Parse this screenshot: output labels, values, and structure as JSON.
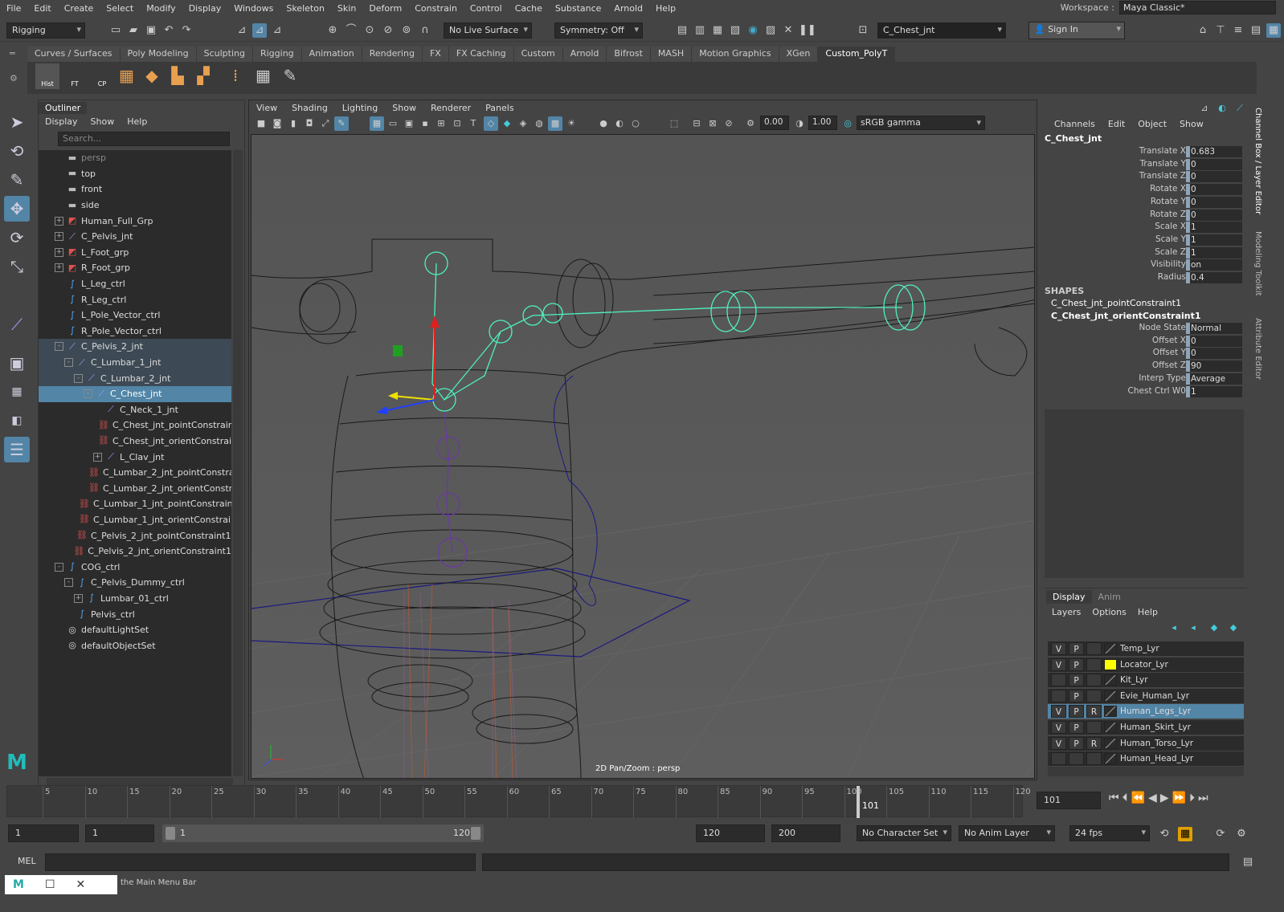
{
  "menu": [
    "File",
    "Edit",
    "Create",
    "Select",
    "Modify",
    "Display",
    "Windows",
    "Skeleton",
    "Skin",
    "Deform",
    "Constrain",
    "Control",
    "Cache",
    "Substance",
    "Arnold",
    "Help"
  ],
  "workspace": {
    "label": "Workspace :",
    "value": "Maya Classic*"
  },
  "status": {
    "mode": "Rigging",
    "live_surface": "No Live Surface",
    "symmetry": "Symmetry: Off",
    "selection": "C_Chest_jnt",
    "sign_in": "Sign In"
  },
  "shelf": {
    "tabs": [
      "Curves / Surfaces",
      "Poly Modeling",
      "Sculpting",
      "Rigging",
      "Animation",
      "Rendering",
      "FX",
      "FX Caching",
      "Custom",
      "Arnold",
      "Bifrost",
      "MASH",
      "Motion Graphics",
      "XGen",
      "Custom_PolyT"
    ],
    "active": "Custom_PolyT",
    "buttons": [
      "Hist",
      "FT",
      "CP"
    ]
  },
  "outliner": {
    "title": "Outliner",
    "menu": [
      "Display",
      "Show",
      "Help"
    ],
    "search_placeholder": "Search...",
    "items": [
      {
        "label": "persp",
        "depth": 0,
        "icon": "camera",
        "dim": true
      },
      {
        "label": "top",
        "depth": 0,
        "icon": "camera"
      },
      {
        "label": "front",
        "depth": 0,
        "icon": "camera"
      },
      {
        "label": "side",
        "depth": 0,
        "icon": "camera"
      },
      {
        "label": "Human_Full_Grp",
        "depth": 0,
        "icon": "group",
        "exp": "+"
      },
      {
        "label": "C_Pelvis_jnt",
        "depth": 0,
        "icon": "joint",
        "exp": "+"
      },
      {
        "label": "L_Foot_grp",
        "depth": 0,
        "icon": "group",
        "exp": "+"
      },
      {
        "label": "R_Foot_grp",
        "depth": 0,
        "icon": "group",
        "exp": "+"
      },
      {
        "label": "L_Leg_ctrl",
        "depth": 0,
        "icon": "curve"
      },
      {
        "label": "R_Leg_ctrl",
        "depth": 0,
        "icon": "curve"
      },
      {
        "label": "L_Pole_Vector_ctrl",
        "depth": 0,
        "icon": "curve"
      },
      {
        "label": "R_Pole_Vector_ctrl",
        "depth": 0,
        "icon": "curve"
      },
      {
        "label": "C_Pelvis_2_jnt",
        "depth": 0,
        "icon": "joint",
        "exp": "-",
        "parent": true
      },
      {
        "label": "C_Lumbar_1_jnt",
        "depth": 1,
        "icon": "joint",
        "exp": "-",
        "parent": true
      },
      {
        "label": "C_Lumbar_2_jnt",
        "depth": 2,
        "icon": "joint",
        "exp": "-",
        "parent": true
      },
      {
        "label": "C_Chest_jnt",
        "depth": 3,
        "icon": "joint",
        "exp": "-",
        "sel": true
      },
      {
        "label": "C_Neck_1_jnt",
        "depth": 4,
        "icon": "joint"
      },
      {
        "label": "C_Chest_jnt_pointConstrain",
        "depth": 4,
        "icon": "constraint"
      },
      {
        "label": "C_Chest_jnt_orientConstrai",
        "depth": 4,
        "icon": "constraint"
      },
      {
        "label": "L_Clav_jnt",
        "depth": 4,
        "icon": "joint",
        "exp": "+"
      },
      {
        "label": "C_Lumbar_2_jnt_pointConstra",
        "depth": 3,
        "icon": "constraint"
      },
      {
        "label": "C_Lumbar_2_jnt_orientConstra",
        "depth": 3,
        "icon": "constraint"
      },
      {
        "label": "C_Lumbar_1_jnt_pointConstraint",
        "depth": 2,
        "icon": "constraint"
      },
      {
        "label": "C_Lumbar_1_jnt_orientConstrain",
        "depth": 2,
        "icon": "constraint"
      },
      {
        "label": "C_Pelvis_2_jnt_pointConstraint1",
        "depth": 1,
        "icon": "constraint"
      },
      {
        "label": "C_Pelvis_2_jnt_orientConstraint1",
        "depth": 1,
        "icon": "constraint"
      },
      {
        "label": "COG_ctrl",
        "depth": 0,
        "icon": "curve",
        "exp": "-"
      },
      {
        "label": "C_Pelvis_Dummy_ctrl",
        "depth": 1,
        "icon": "curve",
        "exp": "-"
      },
      {
        "label": "Lumbar_01_ctrl",
        "depth": 2,
        "icon": "curve",
        "exp": "+"
      },
      {
        "label": "Pelvis_ctrl",
        "depth": 1,
        "icon": "curve"
      },
      {
        "label": "defaultLightSet",
        "depth": 0,
        "icon": "set"
      },
      {
        "label": "defaultObjectSet",
        "depth": 0,
        "icon": "set"
      }
    ]
  },
  "viewport": {
    "menu": [
      "View",
      "Shading",
      "Lighting",
      "Show",
      "Renderer",
      "Panels"
    ],
    "near": "0.00",
    "far": "1.00",
    "colorspace": "sRGB gamma",
    "label": "2D Pan/Zoom : persp"
  },
  "channelbox": {
    "menu": [
      "Channels",
      "Edit",
      "Object",
      "Show"
    ],
    "object": "C_Chest_jnt",
    "attrs": [
      [
        "Translate X",
        "0.683"
      ],
      [
        "Translate Y",
        "0"
      ],
      [
        "Translate Z",
        "0"
      ],
      [
        "Rotate X",
        "0"
      ],
      [
        "Rotate Y",
        "0"
      ],
      [
        "Rotate Z",
        "0"
      ],
      [
        "Scale X",
        "1"
      ],
      [
        "Scale Y",
        "1"
      ],
      [
        "Scale Z",
        "1"
      ],
      [
        "Visibility",
        "on"
      ],
      [
        "Radius",
        "0.4"
      ]
    ],
    "shapes_label": "SHAPES",
    "shapes": [
      "C_Chest_jnt_pointConstraint1",
      "C_Chest_jnt_orientConstraint1"
    ],
    "constraint_attrs": [
      [
        "Node State",
        "Normal"
      ],
      [
        "Offset X",
        "0"
      ],
      [
        "Offset Y",
        "0"
      ],
      [
        "Offset Z",
        "90"
      ],
      [
        "Interp Type",
        "Average"
      ],
      [
        "Chest Ctrl W0",
        "1"
      ]
    ]
  },
  "sidetabs": [
    "Channel Box / Layer Editor",
    "Modeling Toolkit",
    "Attribute Editor"
  ],
  "layers": {
    "tabs": [
      "Display",
      "Anim"
    ],
    "menu": [
      "Layers",
      "Options",
      "Help"
    ],
    "rows": [
      {
        "name": "Temp_Lyr",
        "v": "V",
        "p": "P",
        "r": "",
        "color": ""
      },
      {
        "name": "Locator_Lyr",
        "v": "V",
        "p": "P",
        "r": "",
        "color": "#ffff00"
      },
      {
        "name": "Kit_Lyr",
        "v": "",
        "p": "P",
        "r": "",
        "color": ""
      },
      {
        "name": "Evie_Human_Lyr",
        "v": "",
        "p": "P",
        "r": "",
        "color": ""
      },
      {
        "name": "Human_Legs_Lyr",
        "v": "V",
        "p": "P",
        "r": "R",
        "color": "",
        "sel": true
      },
      {
        "name": "Human_Skirt_Lyr",
        "v": "V",
        "p": "P",
        "r": "",
        "color": ""
      },
      {
        "name": "Human_Torso_Lyr",
        "v": "V",
        "p": "P",
        "r": "R",
        "color": ""
      },
      {
        "name": "Human_Head_Lyr",
        "v": "",
        "p": "",
        "r": "",
        "color": ""
      }
    ]
  },
  "timeline": {
    "ticks": [
      "5",
      "10",
      "15",
      "20",
      "25",
      "30",
      "35",
      "40",
      "45",
      "50",
      "55",
      "60",
      "65",
      "70",
      "75",
      "80",
      "85",
      "90",
      "95",
      "100",
      "105",
      "110",
      "115",
      "120"
    ],
    "current": "101",
    "current_field": "101"
  },
  "range": {
    "start": "1",
    "start2": "1",
    "inner_start": "1",
    "inner_end": "120",
    "end": "120",
    "end2": "200",
    "char_set": "No Character Set",
    "anim_layer": "No Anim Layer",
    "fps": "24 fps"
  },
  "mel": {
    "label": "MEL"
  },
  "help_line": "the Main Menu Bar"
}
